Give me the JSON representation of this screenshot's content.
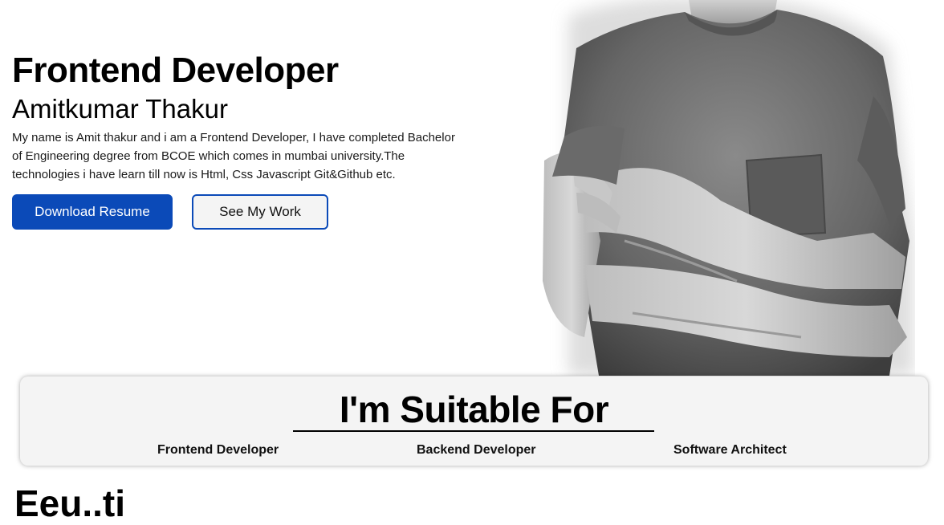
{
  "hero": {
    "title": "Frontend Developer",
    "name": "Amitkumar Thakur",
    "description": "My name is Amit thakur and i am a Frontend Developer, I have completed Bachelor of Engineering degree from BCOE which comes in mumbai university.The technologies i have learn till now is Html, Css Javascript Git&Github etc.",
    "primary_button": "Download Resume",
    "secondary_button": "See My Work"
  },
  "suitable": {
    "heading": "I'm Suitable For",
    "roles": [
      "Frontend Developer",
      "Backend Developer",
      "Software Architect"
    ]
  },
  "next_section": {
    "heading_partial": "Eeu..ti"
  },
  "colors": {
    "accent": "#0b4ab8",
    "card_background": "#f4f4f4"
  }
}
